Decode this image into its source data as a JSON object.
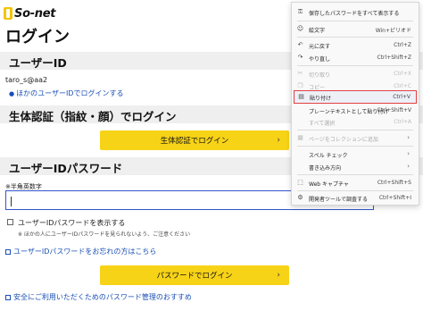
{
  "logo": {
    "text": "So-net"
  },
  "page": {
    "title": "ログイン",
    "userid_section": "ユーザーID",
    "userid_value": "taro_s@aa2",
    "other_userid_link": "ほかのユーザーIDでログインする",
    "biometric_section": "生体認証（指紋・顔）でログイン",
    "biometric_button": "生体認証でログイン",
    "password_section": "ユーザーIDパスワード",
    "password_hint": "※半角英数字",
    "show_password_label": "ユーザーIDパスワードを表示する",
    "show_password_note": "※ ほかの人にユーザーIDパスワードを見られないよう、ご注意ください",
    "forgot_link": "ユーザーIDパスワードをお忘れの方はこちら",
    "password_login_button": "パスワードでログイン",
    "security_link": "安全にご利用いただくためのパスワード管理のおすすめ",
    "chevron": "›"
  },
  "context_menu": {
    "items": [
      {
        "label": "保存したパスワードをすべて表示する",
        "shortcut": "",
        "icon": "key-icon",
        "glyph": "⚿",
        "disabled": false
      },
      {
        "label": "絵文字",
        "shortcut": "Win+ピリオド",
        "icon": "emoji-icon",
        "glyph": "☺",
        "disabled": false
      },
      {
        "label": "元に戻す",
        "shortcut": "Ctrl+Z",
        "icon": "undo-icon",
        "glyph": "↶",
        "disabled": false
      },
      {
        "label": "やり直し",
        "shortcut": "Ctrl+Shift+Z",
        "icon": "redo-icon",
        "glyph": "↷",
        "disabled": false
      },
      {
        "label": "切り取り",
        "shortcut": "Ctrl+X",
        "icon": "cut-icon",
        "glyph": "✂",
        "disabled": true
      },
      {
        "label": "コピー",
        "shortcut": "Ctrl+C",
        "icon": "copy-icon",
        "glyph": "❐",
        "disabled": true
      },
      {
        "label": "貼り付け",
        "shortcut": "Ctrl+V",
        "icon": "paste-icon",
        "glyph": "▤",
        "disabled": false
      },
      {
        "label": "プレーンテキストとして貼り付け",
        "shortcut": "Ctrl+Shift+V",
        "icon": "",
        "glyph": "",
        "disabled": false
      },
      {
        "label": "すべて選択",
        "shortcut": "Ctrl+A",
        "icon": "",
        "glyph": "",
        "disabled": true
      },
      {
        "label": "ページをコレクションに追加",
        "shortcut": "",
        "icon": "collections-icon",
        "glyph": "▦",
        "disabled": true
      },
      {
        "label": "スペル チェック",
        "shortcut": "",
        "icon": "",
        "glyph": "",
        "disabled": false
      },
      {
        "label": "書き込み方向",
        "shortcut": "",
        "icon": "",
        "glyph": "",
        "disabled": false
      },
      {
        "label": "Web キャプチャ",
        "shortcut": "Ctrl+Shift+S",
        "icon": "web-capture-icon",
        "glyph": "⬚",
        "disabled": false
      },
      {
        "label": "開発者ツールで調査する",
        "shortcut": "Ctrl+Shift+I",
        "icon": "devtools-icon",
        "glyph": "⚙",
        "disabled": false
      }
    ]
  }
}
